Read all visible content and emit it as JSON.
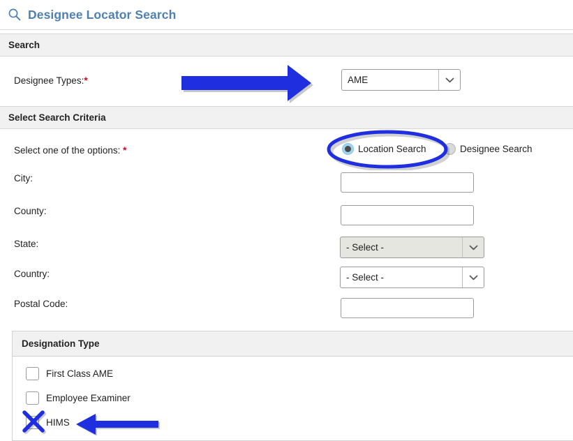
{
  "page": {
    "title": "Designee Locator Search",
    "title_icon": "search-icon",
    "title_color": "#4e80b4"
  },
  "sections": {
    "search": {
      "label": "Search"
    },
    "criteria": {
      "label": "Select Search Criteria"
    },
    "designation": {
      "label": "Designation Type"
    }
  },
  "search_section": {
    "designee_types": {
      "label": "Designee Types:",
      "required_marker": "*",
      "value": "AME",
      "dropdown_icon": "chevron-down-icon"
    }
  },
  "criteria_section": {
    "options_prompt": {
      "label": "Select one of the options:",
      "required_marker": "*"
    },
    "radios": [
      {
        "label": "Location Search",
        "checked": true
      },
      {
        "label": "Designee Search",
        "checked": false
      }
    ],
    "fields": [
      {
        "label": "City:",
        "type": "text",
        "value": "",
        "placeholder": ""
      },
      {
        "label": "County:",
        "type": "text",
        "value": "",
        "placeholder": ""
      },
      {
        "label": "State:",
        "type": "select",
        "value": "- Select -",
        "style": "gray"
      },
      {
        "label": "Country:",
        "type": "select",
        "value": "- Select -",
        "style": "white"
      },
      {
        "label": "Postal Code:",
        "type": "text",
        "value": "",
        "placeholder": ""
      }
    ]
  },
  "designation_section": {
    "checkboxes": [
      {
        "label": "First Class AME",
        "checked": false
      },
      {
        "label": "Employee Examiner",
        "checked": false
      },
      {
        "label": "HIMS",
        "checked": false
      }
    ]
  },
  "annotations": {
    "color": "#1f2fe0",
    "items": [
      {
        "name": "arrow-to-designee-types-dropdown",
        "shape": "arrow-right"
      },
      {
        "name": "ellipse-around-location-search",
        "shape": "ellipse"
      },
      {
        "name": "x-mark-on-hims-checkbox",
        "shape": "x-mark"
      },
      {
        "name": "arrow-to-hims-checkbox",
        "shape": "arrow-left"
      }
    ]
  }
}
